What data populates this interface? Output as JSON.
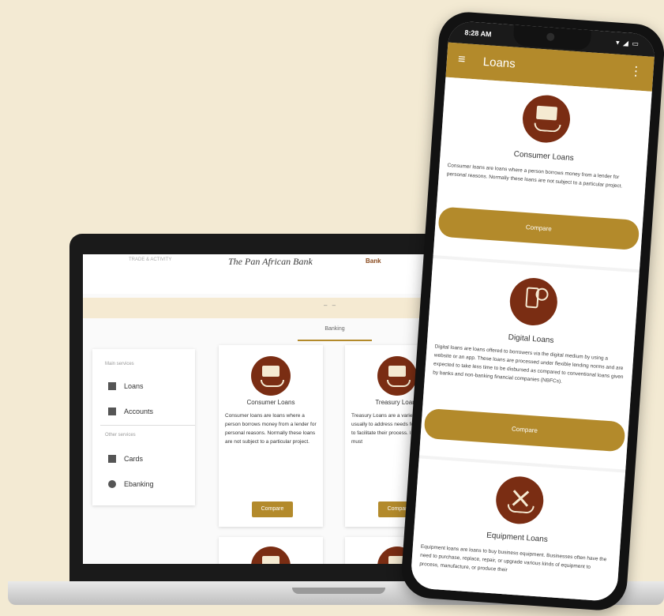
{
  "laptop": {
    "header": {
      "brand_left": "TRADE & ACTIVITY",
      "brand_center": "The Pan African Bank",
      "brand_right": "Bank"
    },
    "band_dots": "– –",
    "tab": "Banking",
    "sidebar": {
      "main_section": "Main services",
      "main_items": [
        "Loans",
        "Accounts"
      ],
      "other_section": "Other services",
      "other_items": [
        "Cards",
        "Ebanking"
      ]
    },
    "cards": [
      {
        "title": "Consumer Loans",
        "text": "Consumer loans are loans where a person borrows money from a lender for personal reasons. Normally these loans are not subject to a particular project.",
        "button": "Compare"
      },
      {
        "title": "Treasury Loans",
        "text": "Treasury Loans are a variety of loans usually to address needs for operations to facilitate their process. In a the loan must",
        "button": "Compare"
      }
    ]
  },
  "phone": {
    "status": {
      "time": "8:28 AM",
      "icons": "▾ ◢ ▭"
    },
    "appbar": {
      "title": "Loans",
      "menu": "≡",
      "more": "⋮"
    },
    "cards": [
      {
        "title": "Consumer Loans",
        "text": "Consumer loans are loans where a person borrows money from a lender for personal reasons. Normally these loans are not subject to a particular project.",
        "button": "Compare"
      },
      {
        "title": "Digital Loans",
        "text": "Digital loans are loans offered to borrowers via the digital medium by using a website or an app. These loans are processed under flexible lending norms and are expected to take less time to be disbursed as compared to conventional loans given by banks and non-banking financial companies (NBFCs).",
        "button": "Compare"
      },
      {
        "title": "Equipment Loans",
        "text": "Equipment loans are loans to buy business equipment. Businesses often have the need to purchase, replace, repair, or upgrade various kinds of equipment to process, manufacture, or produce their"
      }
    ]
  },
  "colors": {
    "brand_gold": "#b38a2b",
    "icon_brown": "#7a2d13",
    "background": "#f3ead3"
  }
}
